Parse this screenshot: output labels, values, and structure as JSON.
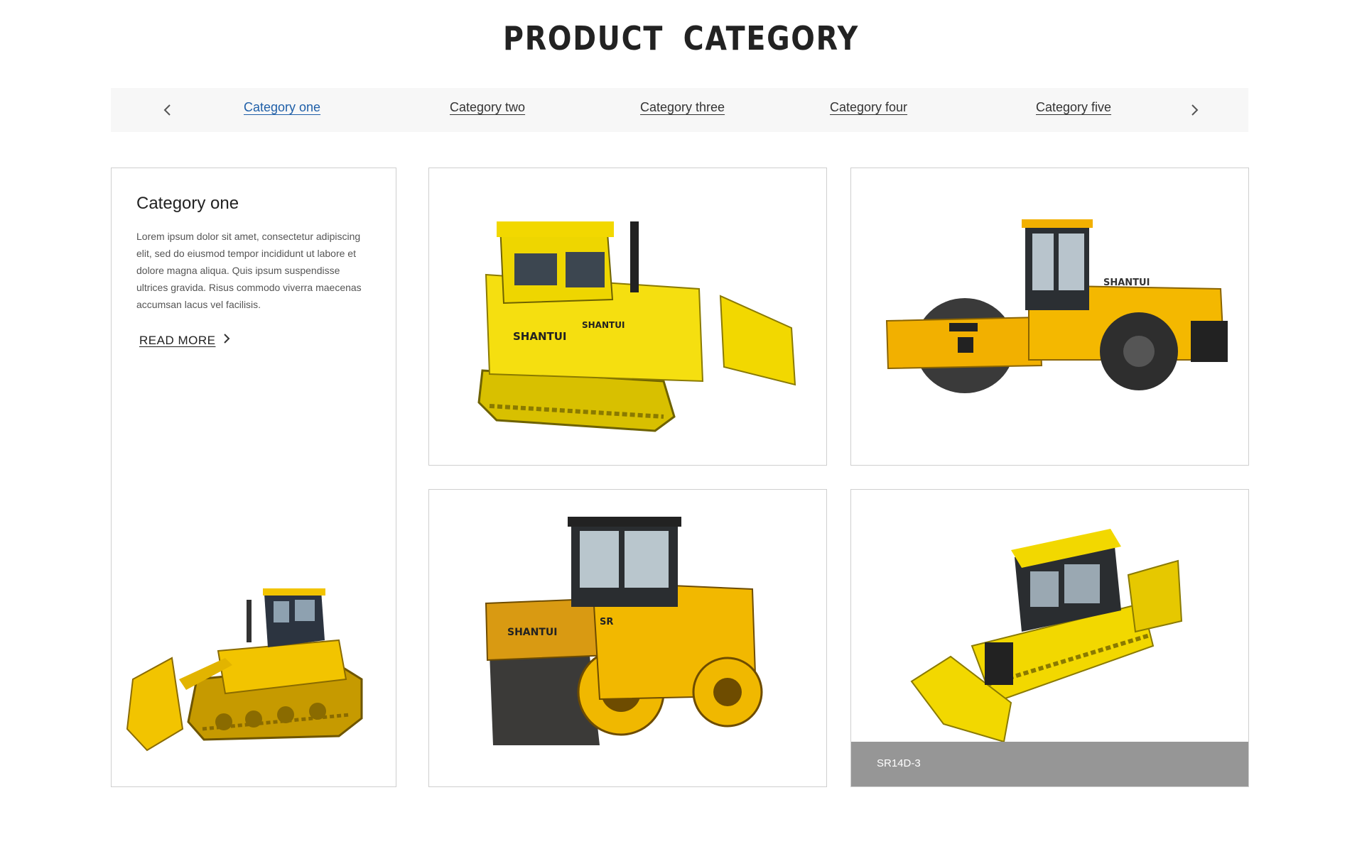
{
  "header": {
    "title": "PRODUCT  CATEGORY"
  },
  "tabs": {
    "prev_icon": "chevron-left-icon",
    "next_icon": "chevron-right-icon",
    "items": [
      {
        "label": "Category one",
        "active": true
      },
      {
        "label": "Category two",
        "active": false
      },
      {
        "label": "Category three",
        "active": false
      },
      {
        "label": "Category four",
        "active": false
      },
      {
        "label": "Category five",
        "active": false
      }
    ]
  },
  "info": {
    "title": "Category one",
    "description": "Lorem ipsum dolor sit amet, consectetur adipiscing elit, sed do eiusmod tempor incididunt ut labore et dolore magna aliqua. Quis ipsum suspendisse ultrices gravida. Risus commodo viverra maecenas accumsan lacus vel facilisis.",
    "read_more": "READ MORE",
    "image": "bulldozer-image"
  },
  "products": [
    {
      "image": "crawler-dozer-image",
      "caption": ""
    },
    {
      "image": "road-roller-image",
      "caption": ""
    },
    {
      "image": "tandem-roller-image",
      "caption": ""
    },
    {
      "image": "dozer-image",
      "caption": "SR14D-3"
    }
  ],
  "colors": {
    "accent": "#1f5fa8",
    "machine_yellow": "#f2c400",
    "caption_bg": "#969696",
    "tab_bar_bg": "#f7f7f7"
  }
}
